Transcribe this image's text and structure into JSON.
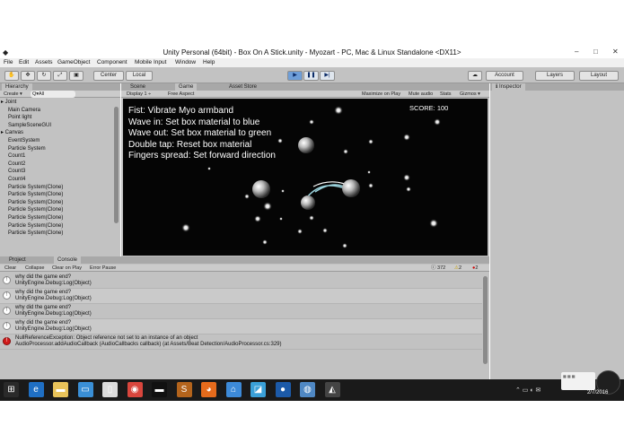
{
  "window": {
    "title": "Unity Personal (64bit) - Box On A Stick.unity - Myozart - PC, Mac & Linux Standalone <DX11>",
    "minimize": "–",
    "maximize": "□",
    "close": "✕"
  },
  "menu": [
    "File",
    "Edit",
    "Assets",
    "GameObject",
    "Component",
    "Mobile Input",
    "Window",
    "Help"
  ],
  "toolbar": {
    "center_label": "Center",
    "local_label": "Local",
    "account_label": "Account",
    "layers_label": "Layers",
    "layout_label": "Layout",
    "play_glyph": "▶",
    "pause_glyph": "❚❚",
    "step_glyph": "▶|"
  },
  "hierarchy": {
    "tab": "Hierarchy",
    "create_label": "Create ▾",
    "search_placeholder": "Q▾All",
    "items": [
      "▸ Joint",
      "Main Camera",
      "Point light",
      "SampleSceneGUI",
      "▸ Canvas",
      "EventSystem",
      "Particle System",
      "Count1",
      "Count2",
      "Count3",
      "Count4",
      "Particle System(Clone)",
      "Particle System(Clone)",
      "Particle System(Clone)",
      "Particle System(Clone)",
      "Particle System(Clone)",
      "Particle System(Clone)",
      "Particle System(Clone)"
    ]
  },
  "game_panel": {
    "tabs": [
      "Scene",
      "Game",
      "Asset Store"
    ],
    "display": "Display 1 ÷",
    "aspect": "Free Aspect",
    "buttons": [
      "Maximize on Play",
      "Mute audio",
      "Stats",
      "Gizmos ▾"
    ],
    "instructions": [
      "Fist: Vibrate Myo armband",
      "Wave in: Set box material to blue",
      "Wave out: Set box material to green",
      "Double tap: Reset box material",
      "Fingers spread: Set forward direction"
    ],
    "score": "SCORE: 100"
  },
  "inspector": {
    "tab": "Inspector"
  },
  "console": {
    "tabs": [
      "Project",
      "Console"
    ],
    "buttons": [
      "Clear",
      "Collapse",
      "Clear on Play",
      "Error Pause"
    ],
    "counts": {
      "info": "372",
      "warn": "2",
      "error": "2"
    },
    "entries": [
      {
        "line1": "why did the game end?",
        "line2": "UnityEngine.Debug:Log(Object)",
        "level": "info"
      },
      {
        "line1": "why did the game end?",
        "line2": "UnityEngine.Debug:Log(Object)",
        "level": "info"
      },
      {
        "line1": "why did the game end?",
        "line2": "UnityEngine.Debug:Log(Object)",
        "level": "info"
      },
      {
        "line1": "why did the game end?",
        "line2": "UnityEngine.Debug:Log(Object)",
        "level": "info"
      },
      {
        "line1": "NullReferenceException: Object reference not set to an instance of an object",
        "line2": "AudioProcessor.addAudioCallback (AudioCallbacks callback) (at Assets/Beat Detection/AudioProcessor.cs:329)",
        "level": "error"
      }
    ]
  },
  "taskbar": {
    "icons": [
      "start-icon",
      "ie-icon",
      "explorer-icon",
      "remote-icon",
      "file-icon",
      "chrome-icon",
      "terminal-icon",
      "sublime-icon",
      "firefox-icon",
      "home-icon",
      "docs-icon",
      "globe-icon",
      "network-icon",
      "unity-icon"
    ],
    "clock": "2/7/2016"
  }
}
